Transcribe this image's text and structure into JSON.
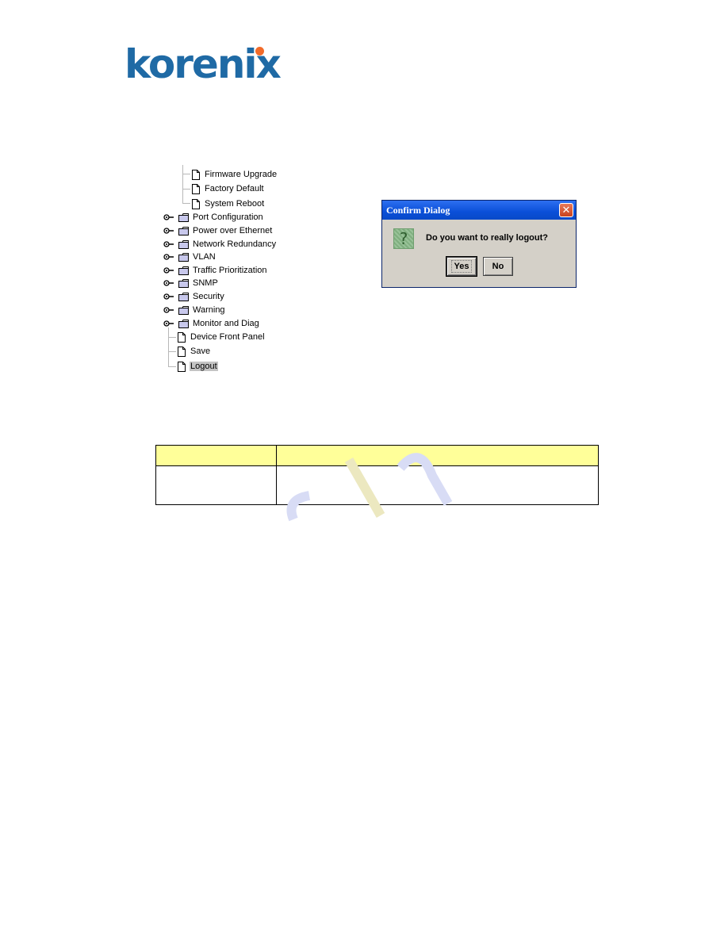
{
  "logo": {
    "text": "korenix",
    "brand_color": "#1f6aa5",
    "dot_color": "#f26b2a"
  },
  "tree": {
    "sub_items": [
      {
        "label": "Firmware Upgrade",
        "icon": "document-icon"
      },
      {
        "label": "Factory Default",
        "icon": "document-icon"
      },
      {
        "label": "System Reboot",
        "icon": "document-icon"
      }
    ],
    "folders": [
      {
        "label": "Port Configuration",
        "icon": "folder-icon"
      },
      {
        "label": "Power over Ethernet",
        "icon": "folder-icon"
      },
      {
        "label": "Network Redundancy",
        "icon": "folder-icon"
      },
      {
        "label": "VLAN",
        "icon": "folder-icon"
      },
      {
        "label": "Traffic Prioritization",
        "icon": "folder-icon"
      },
      {
        "label": "SNMP",
        "icon": "folder-icon"
      },
      {
        "label": "Security",
        "icon": "folder-icon"
      },
      {
        "label": "Warning",
        "icon": "folder-icon"
      },
      {
        "label": "Monitor and Diag",
        "icon": "folder-icon"
      }
    ],
    "leaves": [
      {
        "label": "Device Front Panel",
        "icon": "document-icon"
      },
      {
        "label": "Save",
        "icon": "document-icon"
      },
      {
        "label": "Logout",
        "icon": "document-icon",
        "selected": true
      }
    ]
  },
  "dialog": {
    "title": "Confirm Dialog",
    "icon": "question-icon",
    "icon_glyph": "?",
    "close_glyph": "✕",
    "message": "Do you want to really logout?",
    "yes_label": "Yes",
    "no_label": "No"
  },
  "table": {
    "header": [
      "",
      ""
    ],
    "rows": [
      [
        "",
        ""
      ]
    ],
    "header_color": "#ffff99"
  }
}
